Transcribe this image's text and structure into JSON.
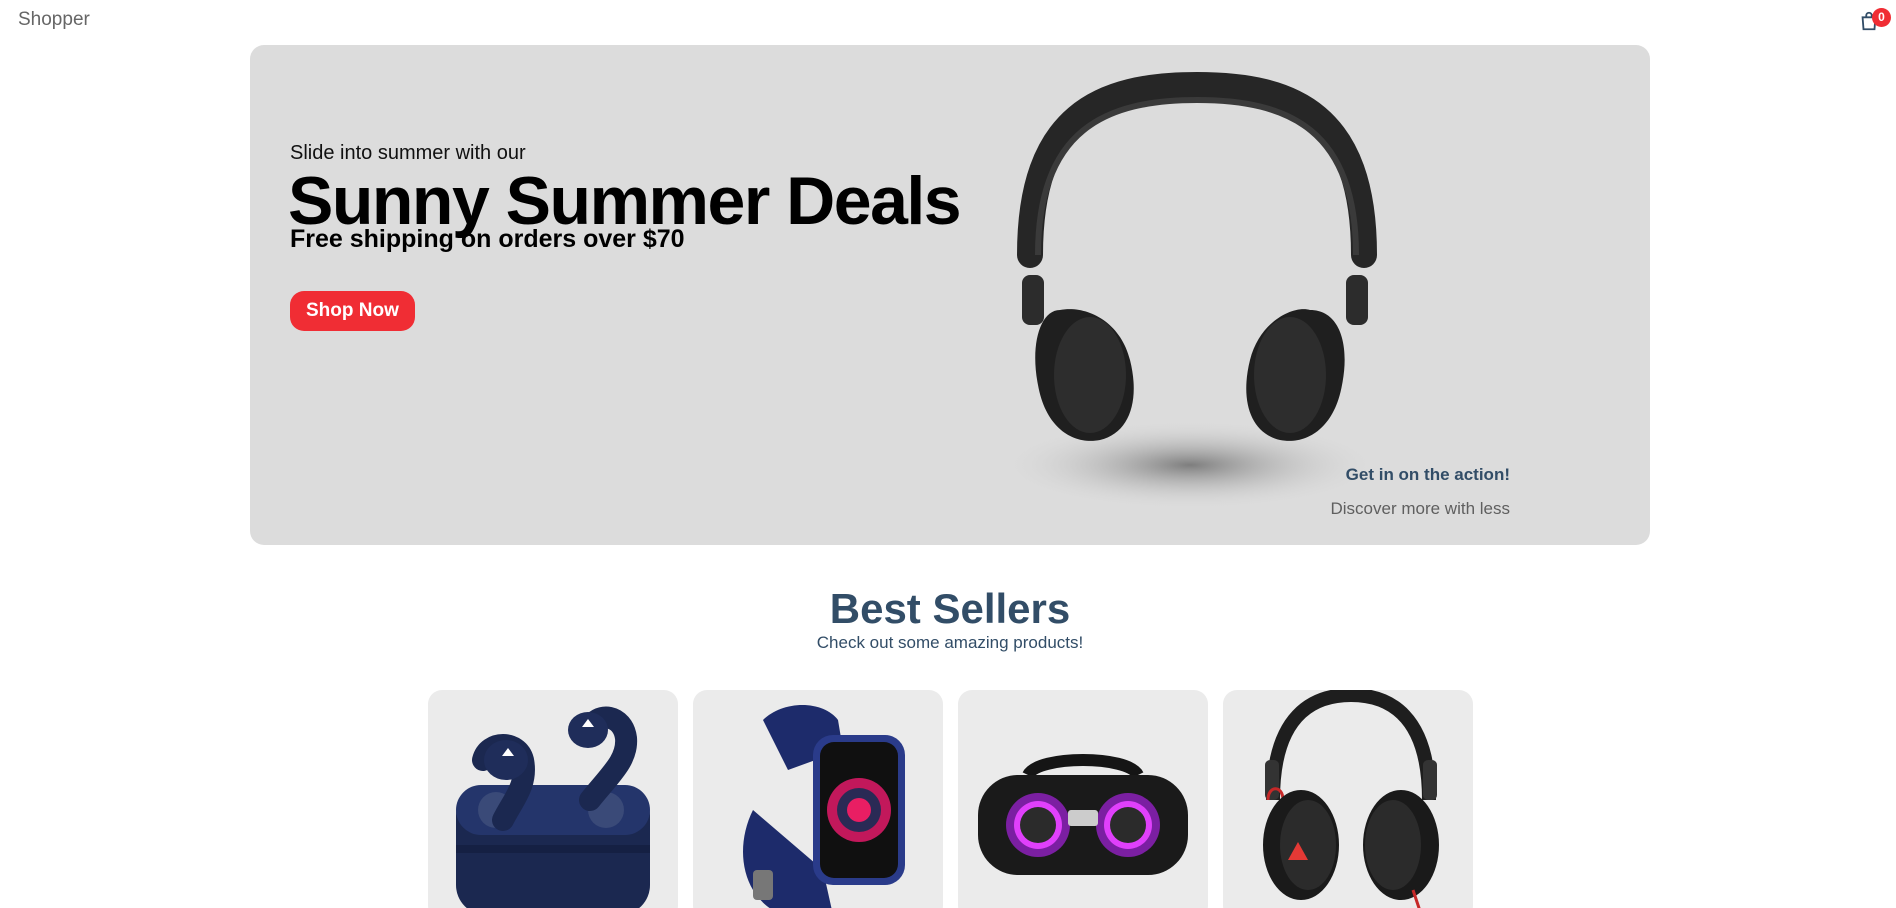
{
  "navbar": {
    "logo": "Shopper",
    "cart_count": "0"
  },
  "hero": {
    "small_text": "Slide into summer with our",
    "mid_text": "Sunny Summer Deals",
    "large_text": "Free shipping on orders over $70",
    "button_label": "Shop Now",
    "desc_title": "Get in on the action!",
    "desc_text": "Discover more with less",
    "image_icon": "headphones-icon"
  },
  "best_sellers": {
    "title": "Best Sellers",
    "subtitle": "Check out some amazing products!",
    "products": [
      {
        "icon": "earbuds-icon"
      },
      {
        "icon": "smartwatch-icon"
      },
      {
        "icon": "speaker-icon"
      },
      {
        "icon": "headphones-icon"
      }
    ]
  },
  "colors": {
    "accent": "#f02d34",
    "heading": "#324d67",
    "hero_bg": "#dcdcdc",
    "card_bg": "#ebebeb"
  }
}
